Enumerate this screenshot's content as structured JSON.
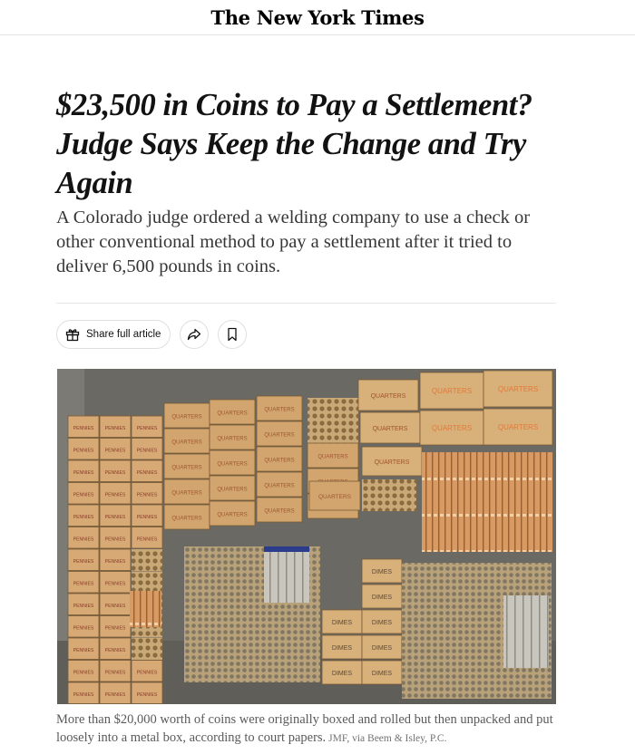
{
  "masthead": {
    "logo_text": "The New York Times"
  },
  "article": {
    "headline": "$23,500 in Coins to Pay a Settlement? Judge Says Keep the Change and Try Again",
    "summary": "A Colorado judge ordered a welding company to use a check or other conventional method to pay a settlement after it tried to deliver 6,500 pounds in coins."
  },
  "share": {
    "share_full_article_label": "Share full article",
    "icons": {
      "gift": "gift-icon",
      "share": "share-arrow-icon",
      "save": "bookmark-icon"
    }
  },
  "photo": {
    "box_labels": {
      "pennies": "PENNIES",
      "quarters": "QUARTERS",
      "dimes": "DIMES"
    }
  },
  "caption": {
    "text": "More than $20,000 worth of coins were originally boxed and rolled but then unpacked and put loosely into a metal box, according to court papers.",
    "credit": "JMF, via Beem & Isley, P.C."
  }
}
